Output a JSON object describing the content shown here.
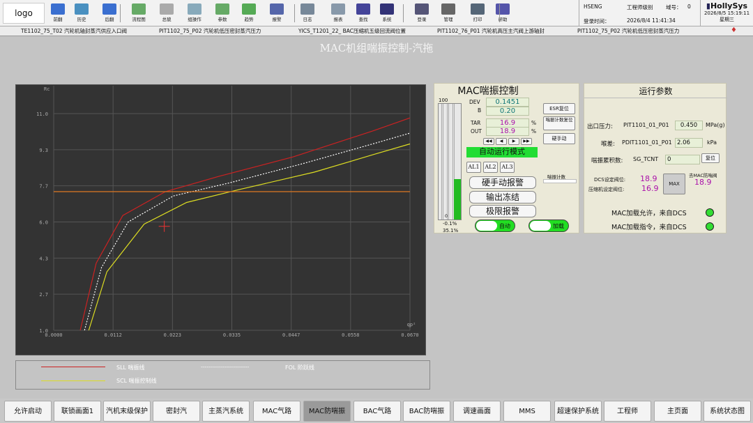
{
  "header": {
    "logo": "logo",
    "toolbar": [
      "前翻",
      "历史",
      "后翻",
      "流程图",
      "总貌",
      "组操作",
      "参数",
      "趋势",
      "报警",
      "日志",
      "报表",
      "查找",
      "系统",
      "登录",
      "管理",
      "打印",
      "帮助"
    ]
  },
  "user": {
    "domain": "HSENG",
    "role": "工程师级别",
    "domain_no_label": "域号：",
    "domain_no": "0",
    "login_label": "登录时间：",
    "login_time": "2026/8/4 11:41:34"
  },
  "brand": {
    "name": "HollySys",
    "datetime": "2026/8/5 15:19:11",
    "weekday": "星期三"
  },
  "alarms": [
    {
      "tag": "TE1102_75_T02",
      "desc": "汽轮机轴封蒸汽供应入口阀"
    },
    {
      "tag": "PIT1102_75_P02",
      "desc": "汽轮机低压密封蒸汽压力"
    },
    {
      "tag": "YICS_T1201_22_",
      "desc": "BAC压缩机五级回流阀位置"
    },
    {
      "tag": "PIT1102_76_P01",
      "desc": "汽轮机高压主汽阀上游轴封"
    },
    {
      "tag": "PIT1102_75_P02",
      "desc": "汽轮机低压密封蒸汽压力"
    }
  ],
  "page_title": "MAC机组喘振控制-汽拖",
  "chart_data": {
    "type": "line",
    "xlabel": "qp²",
    "ylabel": "Rc",
    "x_ticks": [
      "0.0000",
      "0.0112",
      "0.0223",
      "0.0335",
      "0.0447",
      "0.0558",
      "0.0670"
    ],
    "y_ticks": [
      "1.0",
      "2.7",
      "4.3",
      "6.0",
      "7.7",
      "9.3",
      "11.0"
    ],
    "xlim": [
      0,
      0.067
    ],
    "ylim": [
      1.0,
      11.0
    ],
    "series": [
      {
        "name": "SLL 喘振线",
        "color": "#cc2222",
        "x": [
          0.005,
          0.008,
          0.013,
          0.021,
          0.031,
          0.045,
          0.06,
          0.067
        ],
        "y": [
          1.0,
          4.1,
          6.3,
          7.4,
          8.1,
          9.0,
          10.2,
          10.8
        ]
      },
      {
        "name": "FOL 阶跃线",
        "color": "#ffffff",
        "x": [
          0.0058,
          0.009,
          0.014,
          0.0225,
          0.033,
          0.047,
          0.06,
          0.067
        ],
        "y": [
          1.0,
          3.9,
          6.0,
          7.2,
          7.8,
          8.7,
          9.6,
          10.1
        ]
      },
      {
        "name": "SCL 喘振控制线",
        "color": "#dddd22",
        "x": [
          0.0066,
          0.01,
          0.017,
          0.025,
          0.035,
          0.049,
          0.06,
          0.067
        ],
        "y": [
          1.0,
          3.7,
          5.9,
          6.9,
          7.5,
          8.3,
          9.1,
          9.6
        ]
      },
      {
        "name": "",
        "color": "#dd7722",
        "x": [
          0.0,
          0.067
        ],
        "y": [
          7.4,
          7.4
        ]
      }
    ],
    "operating_point": {
      "x": 0.0208,
      "y": 5.8
    }
  },
  "legend": {
    "sll": "SLL 喘振线",
    "scl": "SCL 喘振控制线",
    "fol": "FOL 阶跃线",
    "dashes": "------------------------"
  },
  "mac": {
    "title": "MAC喘振控制",
    "dev_label": "DEV",
    "dev": "0.1451",
    "b_label": "B",
    "b": "0.20",
    "tar_label": "TAR",
    "tar": "16.9",
    "out_label": "OUT",
    "out": "18.9",
    "unit": "%",
    "bar_max": "100",
    "bar_min": "0",
    "bar_low": "-0.1%",
    "bar_high": "35.1%",
    "bar_level": 0.35,
    "esr_btn": "ESR复位",
    "reset_btn": "喘振计数复位",
    "manual_btn": "硬手动",
    "count_label": "喘振计数",
    "auto_mode": "自动运行模式",
    "al": [
      "AL1",
      "AL2",
      "AL3"
    ],
    "alarms": [
      "硬手动报警",
      "输出冻结",
      "极限报警"
    ],
    "toggle_auto": "自动",
    "toggle_load": "加载"
  },
  "op": {
    "title": "运行参数",
    "outlet_label": "出口压力:",
    "outlet_tag": "PIT1101_01_P01",
    "outlet_val": "0.450",
    "outlet_unit": "MPa(g)",
    "diff_label": "喉差:",
    "diff_tag": "PDIT1101_01_P01",
    "diff_val": "2.06",
    "diff_unit": "kPa",
    "cum_label": "喘振累积数:",
    "cum_tag": "SG_TCNT",
    "cum_val": "0",
    "reset": "复位",
    "dcs_label": "DCS设定阀位:",
    "dcs_val": "18.9",
    "comp_label": "压缩机设定阀位:",
    "comp_val": "16.9",
    "max_label": "MAX",
    "anti_label": "去MAC防喘阀",
    "anti_val": "18.9",
    "allow": "MAC加载允许，来自DCS",
    "cmd": "MAC加载指令，来自DCS"
  },
  "nav": [
    "允许启动",
    "联锁画面1",
    "汽机末级保护",
    "密封汽",
    "主蒸汽系统",
    "MAC气路",
    "MAC防喘振",
    "BAC气路",
    "BAC防喘振",
    "调速画面",
    "MMS",
    "超速保护系统",
    "工程师",
    "主页面",
    "系统状态图"
  ],
  "nav_active": "MAC防喘振"
}
